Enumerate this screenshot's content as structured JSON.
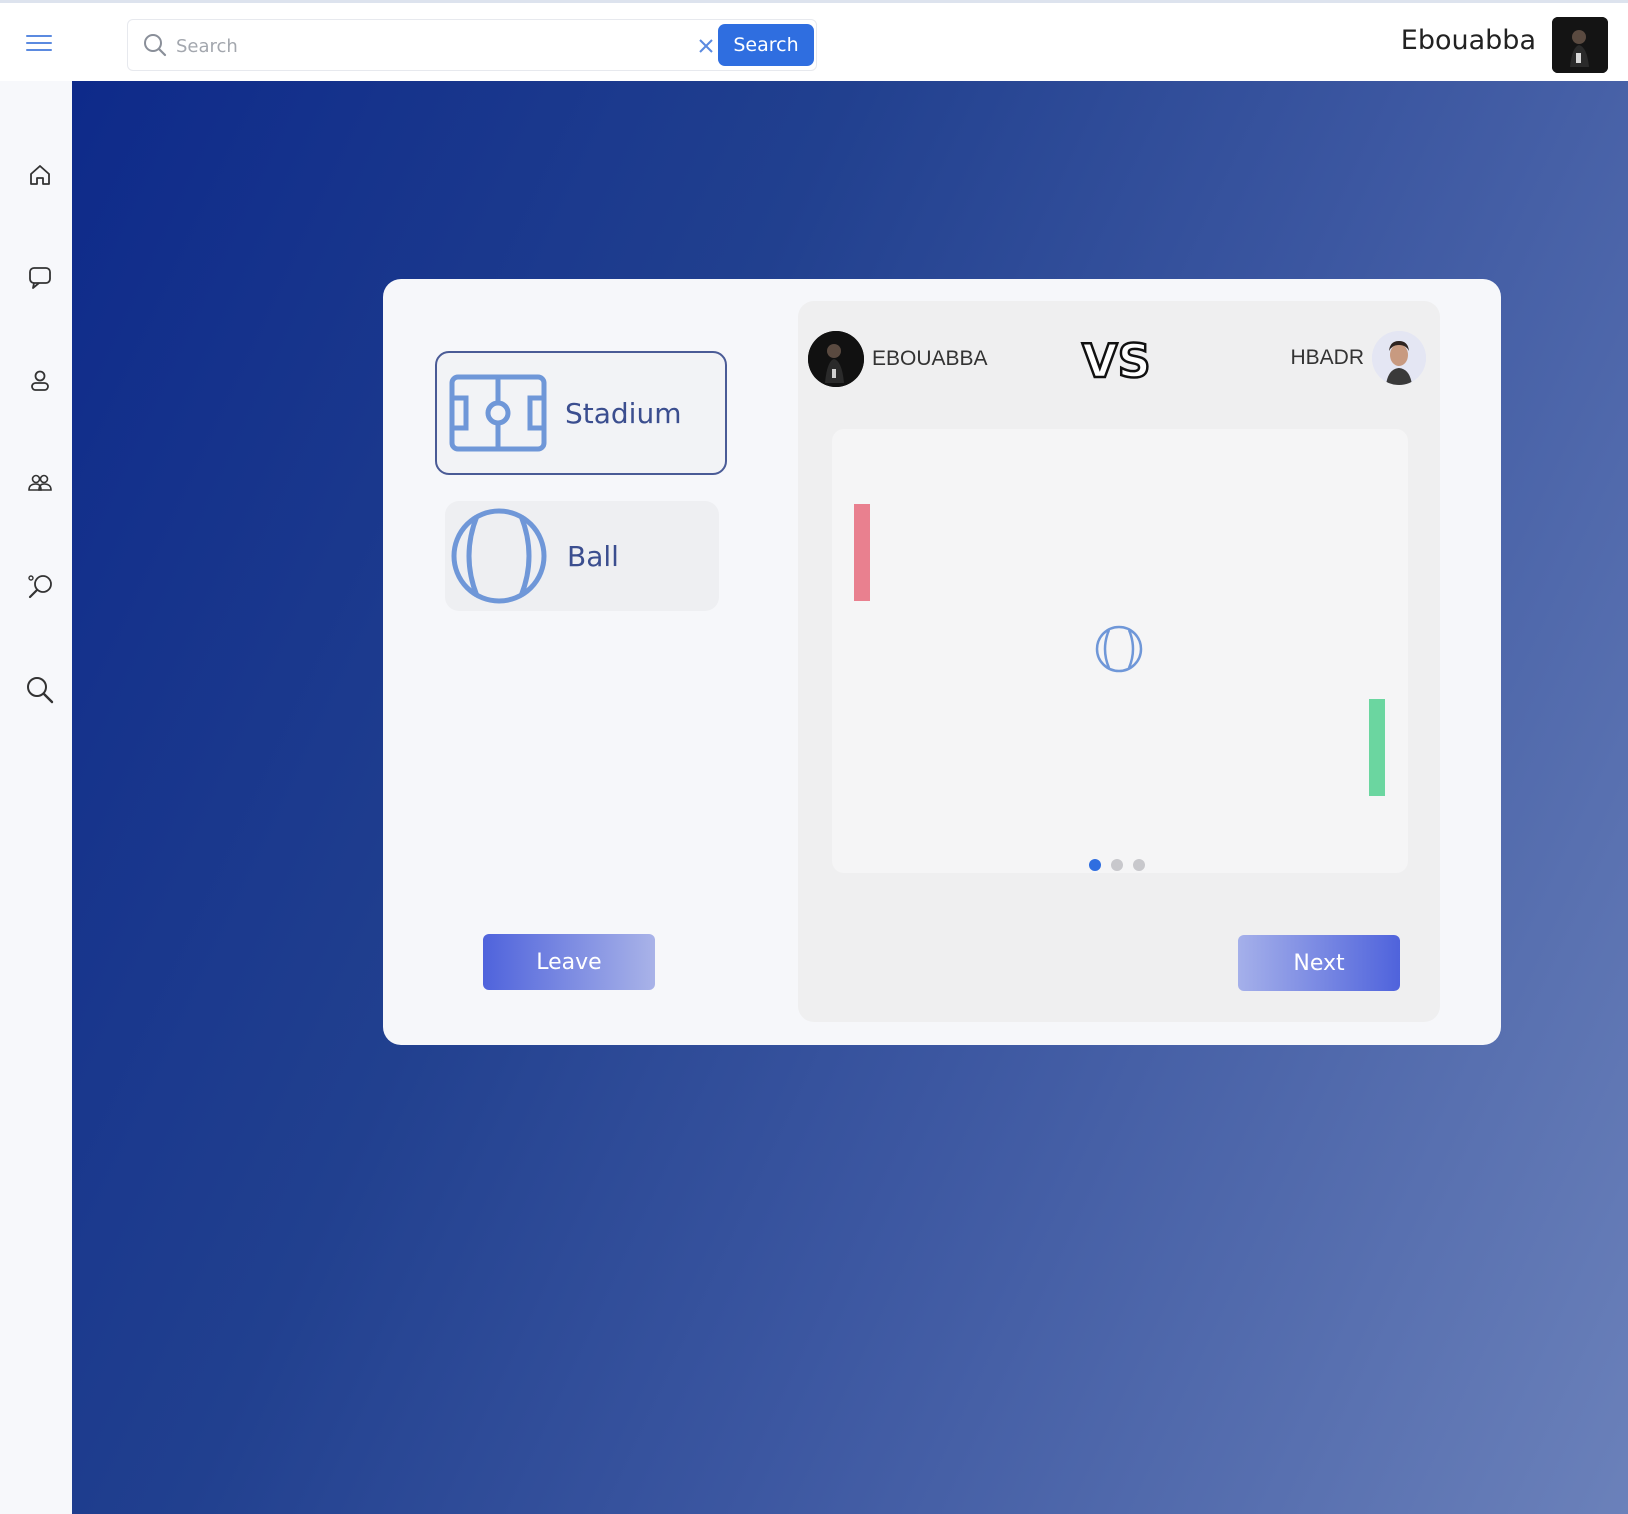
{
  "header": {
    "search_placeholder": "Search",
    "search_value": "",
    "search_button": "Search",
    "username": "Ebouabba"
  },
  "sidebar": {
    "items": [
      {
        "icon": "home-icon"
      },
      {
        "icon": "chat-icon"
      },
      {
        "icon": "profile-icon"
      },
      {
        "icon": "friends-icon"
      },
      {
        "icon": "game-icon"
      },
      {
        "icon": "search-icon"
      }
    ]
  },
  "game_setup": {
    "options": [
      {
        "label": "Stadium",
        "icon": "stadium-icon",
        "selected": true
      },
      {
        "label": "Ball",
        "icon": "ball-icon",
        "selected": false
      }
    ],
    "leave_button": "Leave",
    "next_button": "Next"
  },
  "match": {
    "player_left": "EBOUABBA",
    "player_right": "HBADR",
    "vs_text": "VS",
    "slide_count": 3,
    "active_slide": 1
  },
  "colors": {
    "accent": "#2f6ee0",
    "paddle_left": "#e9808f",
    "paddle_right": "#6bd6a0",
    "option_icon": "#6f97d8",
    "option_text": "#3b4e8f"
  }
}
